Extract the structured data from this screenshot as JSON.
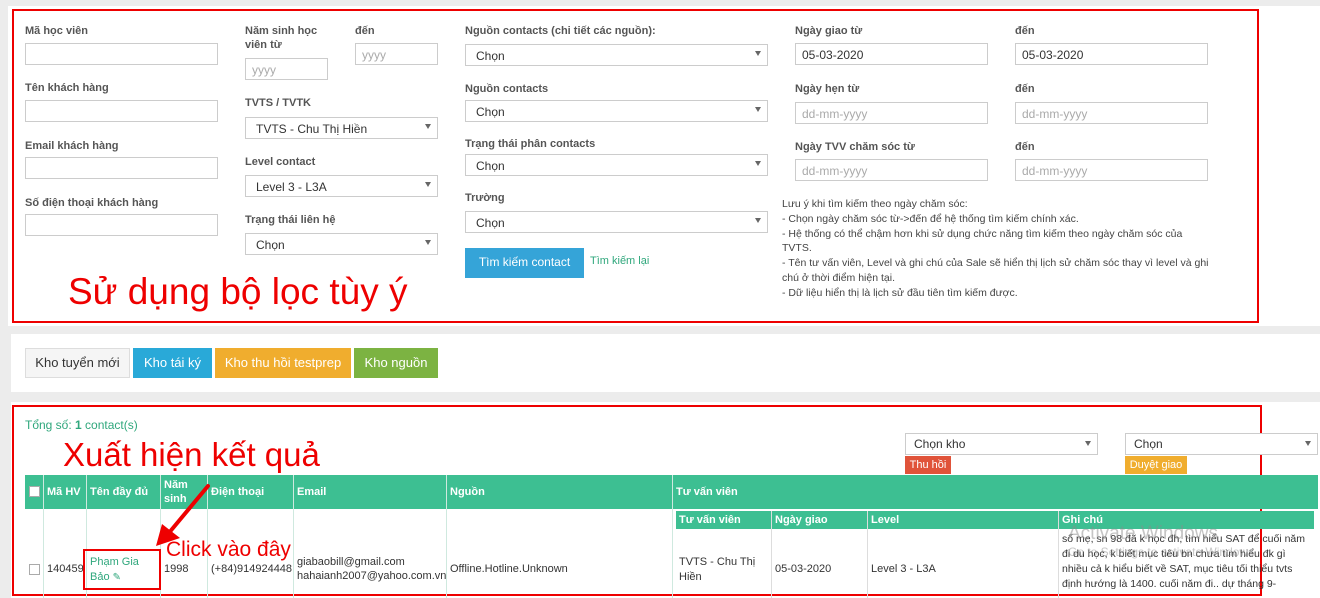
{
  "filters": {
    "ma_hoc_vien": {
      "label": "Mã học viên",
      "value": ""
    },
    "ten_khach_hang": {
      "label": "Tên khách hàng",
      "value": ""
    },
    "email_khach_hang": {
      "label": "Email khách hàng",
      "value": ""
    },
    "so_dien_thoai": {
      "label": "Số điện thoại khách hàng",
      "value": ""
    },
    "nam_sinh_tu": {
      "label": "Năm sinh học viên từ",
      "placeholder": "yyyy"
    },
    "nam_sinh_den": {
      "label": "đến",
      "placeholder": "yyyy"
    },
    "tvts": {
      "label": "TVTS / TVTK",
      "value": "TVTS - Chu Thị Hiền"
    },
    "level_contact": {
      "label": "Level contact",
      "value": "Level 3 - L3A"
    },
    "trang_thai_lien_he": {
      "label": "Trạng thái liên hệ",
      "value": "Chọn"
    },
    "nguon_chi_tiet": {
      "label": "Nguồn contacts (chi tiết các nguồn):",
      "value": "Chọn"
    },
    "nguon_contacts": {
      "label": "Nguồn contacts",
      "value": "Chọn"
    },
    "trang_thai_phan": {
      "label": "Trạng thái phân contacts",
      "value": "Chọn"
    },
    "truong": {
      "label": "Trường",
      "value": "Chọn"
    },
    "ngay_giao_tu": {
      "label": "Ngày giao từ",
      "value": "05-03-2020"
    },
    "ngay_giao_den": {
      "label": "đến",
      "value": "05-03-2020"
    },
    "ngay_hen_tu": {
      "label": "Ngày hẹn từ",
      "placeholder": "dd-mm-yyyy"
    },
    "ngay_hen_den": {
      "label": "đến",
      "placeholder": "dd-mm-yyyy"
    },
    "ngay_tvv_tu": {
      "label": "Ngày TVV chăm sóc từ",
      "placeholder": "dd-mm-yyyy"
    },
    "ngay_tvv_den": {
      "label": "đến",
      "placeholder": "dd-mm-yyyy"
    },
    "search_button": "Tìm kiếm contact",
    "reset_link": "Tìm kiếm lại",
    "notes": [
      "Lưu ý khi tìm kiếm theo ngày chăm sóc:",
      "- Chọn ngày chăm sóc từ->đến để hệ thống tìm kiếm chính xác.",
      "- Hệ thống có thể chậm hơn khi sử dụng chức năng tìm kiếm theo ngày chăm sóc của",
      "TVTS.",
      "- Tên tư vấn viên, Level và ghi chú của Sale sẽ hiển thị lịch sử chăm sóc thay vì level và ghi",
      "chú ở thời điểm hiện tại.",
      "- Dữ liệu hiển thị là lịch sử đầu tiên tìm kiếm được."
    ]
  },
  "annotations": {
    "filter_caption": "Sử dụng bộ lọc tùy ý",
    "result_caption": "Xuất hiện kết quả",
    "click_caption": "Click vào đây"
  },
  "tabs": [
    {
      "label": "Kho tuyển mới",
      "color": "#f5f5f5"
    },
    {
      "label": "Kho tái ký",
      "color": "#29a9d8"
    },
    {
      "label": "Kho thu hồi testprep",
      "color": "#f0ad2e"
    },
    {
      "label": "Kho nguồn",
      "color": "#7cb342"
    }
  ],
  "results": {
    "total_prefix": "Tổng số: ",
    "total_count": "1",
    "total_suffix": " contact(s)",
    "kho_select": "Chọn kho",
    "thu_hoi": "Thu hồi",
    "duyet_select": "Chọn",
    "duyet_giao": "Duyệt giao",
    "headers": {
      "ma_hv": "Mã HV",
      "ten": "Tên đầy đủ",
      "nam_sinh": "Năm sinh",
      "dien_thoai": "Điện thoại",
      "email": "Email",
      "nguon": "Nguồn",
      "tu_van_vien": "Tư vấn viên"
    },
    "sub_headers": {
      "tvv": "Tư vấn viên",
      "ngay_giao": "Ngày giao",
      "level": "Level",
      "ghi_chu": "Ghi chú"
    },
    "row": {
      "ma_hv": "140459",
      "ten": "Phạm Gia Bảo",
      "nam_sinh": "1998",
      "dien_thoai": "(+84)914924448",
      "email1": "giabaobill@gmail.com",
      "email2": "hahaianh2007@yahoo.com.vn",
      "nguon": "Offline.Hotline.Unknown",
      "tvv": "TVTS - Chu Thị Hiền",
      "ngay_giao": "05-03-2020",
      "level": "Level 3 - L3A",
      "ghi_chu": "số mẹ, sn 98 đã k học đh, tìm hiểu SAT để cuối năm đi du học, k biết mục tiêu bn chưa tìm hiểu đk gì nhiều cả k hiểu biết về SAT, mục tiêu tối thiểu tvts định hướng là 1400. cuối năm đi.. dự tháng 9-"
    }
  },
  "watermark": {
    "line1": "Activate Windows",
    "line2": "Go to Settings to activate Windows."
  }
}
